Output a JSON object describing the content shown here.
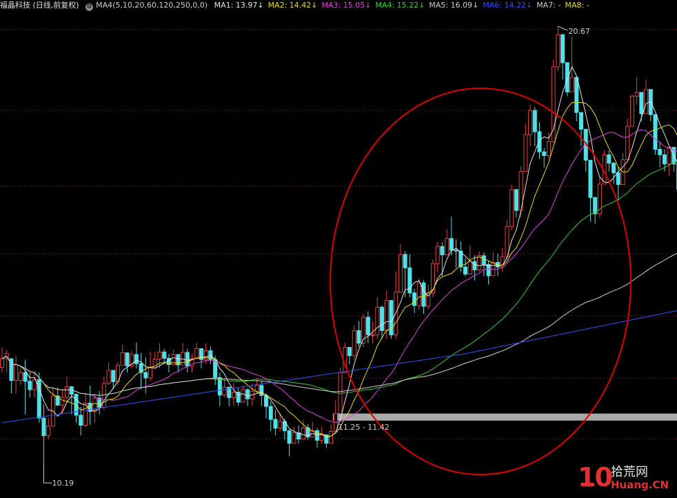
{
  "legend": {
    "title": "福晶科技 (日线,前复权)",
    "indicator": "MA4(5,10,20,60,120,250,0,0)",
    "items": [
      {
        "label": "MA1: 13.97",
        "color": "#e6e6e6",
        "arrow": "↓"
      },
      {
        "label": "MA2: 14.42",
        "color": "#e8e000",
        "arrow": "↓"
      },
      {
        "label": "MA3: 15.05",
        "color": "#e040e0",
        "arrow": "↓"
      },
      {
        "label": "MA4: 15.22",
        "color": "#30d030",
        "arrow": "↓"
      },
      {
        "label": "MA5: 16.09",
        "color": "#d0d0d0",
        "arrow": "↓"
      },
      {
        "label": "MA6: 14.22",
        "color": "#3050ff",
        "arrow": "↓"
      },
      {
        "label": "MA7: -",
        "color": "#d0d0d0",
        "arrow": ""
      },
      {
        "label": "MA8: -",
        "color": "#e8e000",
        "arrow": ""
      }
    ]
  },
  "watermark": {
    "num": "10",
    "cn": "拾荒网",
    "en": "Huang.CN"
  },
  "chart_data": {
    "type": "candlestick",
    "ylim": [
      9.6,
      21.0
    ],
    "annotations": {
      "high": "20.67",
      "low": "10.19",
      "band": "11.25 - 11.42",
      "band_range": [
        11.25,
        11.42
      ]
    },
    "colors": {
      "up": "#e84040",
      "down": "#50e0e8",
      "grid": "#6a1a1a",
      "ma1": "#e6e6e6",
      "ma2": "#e8e000",
      "ma3": "#e040e0",
      "ma4": "#30d030",
      "ma5": "#d0d0d0",
      "ma6": "#3050ff",
      "circle": "#e00000",
      "band": "#a8a8a8"
    },
    "candles": [
      [
        12.52,
        12.73,
        13.0,
        12.4
      ],
      [
        12.73,
        12.85,
        12.94,
        12.4
      ],
      [
        12.73,
        12.21,
        12.73,
        11.9
      ],
      [
        12.21,
        12.58,
        12.8,
        11.9
      ],
      [
        12.21,
        12.4,
        12.57,
        12.1
      ],
      [
        12.4,
        12.19,
        12.7,
        11.4
      ],
      [
        12.19,
        11.99,
        12.4,
        11.8
      ],
      [
        11.99,
        12.23,
        12.43,
        11.8
      ],
      [
        12.23,
        11.31,
        12.4,
        11.2
      ],
      [
        11.31,
        10.89,
        11.64,
        10.19
      ],
      [
        10.89,
        11.12,
        11.32,
        10.8
      ],
      [
        11.12,
        11.84,
        12.05,
        11.8
      ],
      [
        11.84,
        11.62,
        12.04,
        11.6
      ],
      [
        11.62,
        11.81,
        11.98,
        11.4
      ],
      [
        11.81,
        12.06,
        12.3,
        11.7
      ],
      [
        12.06,
        11.88,
        12.08,
        11.4
      ],
      [
        11.88,
        11.38,
        11.9,
        11.2
      ],
      [
        11.38,
        11.14,
        11.58,
        10.9
      ],
      [
        11.14,
        11.67,
        11.91,
        11.1
      ],
      [
        11.67,
        11.47,
        12.09,
        11.15
      ],
      [
        11.47,
        11.79,
        11.9,
        11.2
      ],
      [
        11.79,
        11.57,
        11.96,
        11.4
      ],
      [
        11.57,
        12.14,
        12.3,
        11.5
      ],
      [
        12.14,
        12.45,
        12.64,
        12.1
      ],
      [
        12.45,
        12.18,
        12.44,
        12.0
      ],
      [
        12.18,
        12.57,
        12.64,
        12.1
      ],
      [
        12.57,
        12.87,
        13.07,
        12.6
      ],
      [
        12.87,
        12.56,
        12.88,
        12.4
      ],
      [
        12.56,
        12.83,
        12.92,
        12.5
      ],
      [
        12.83,
        12.61,
        13.12,
        12.5
      ],
      [
        12.61,
        12.4,
        12.87,
        12.0
      ],
      [
        12.4,
        12.27,
        12.76,
        11.9
      ],
      [
        12.27,
        12.51,
        12.9,
        12.2
      ],
      [
        12.51,
        12.72,
        12.9,
        12.5
      ],
      [
        12.72,
        12.89,
        13.1,
        12.5
      ],
      [
        12.89,
        12.74,
        12.96,
        12.6
      ],
      [
        12.74,
        12.59,
        12.84,
        12.4
      ],
      [
        12.59,
        12.83,
        12.94,
        12.6
      ],
      [
        12.83,
        12.58,
        12.8,
        12.4
      ],
      [
        12.58,
        12.88,
        13.1,
        12.6
      ],
      [
        12.88,
        12.55,
        12.97,
        12.4
      ],
      [
        12.55,
        12.73,
        12.85,
        12.4
      ],
      [
        12.73,
        12.97,
        13.11,
        12.8
      ],
      [
        12.97,
        12.71,
        12.94,
        12.5
      ],
      [
        12.71,
        12.92,
        13.09,
        12.6
      ],
      [
        12.92,
        12.71,
        13.02,
        12.6
      ],
      [
        12.71,
        12.28,
        12.8,
        12.1
      ],
      [
        12.28,
        11.86,
        12.4,
        11.6
      ],
      [
        11.86,
        12.05,
        12.24,
        11.8
      ],
      [
        12.05,
        11.8,
        12.04,
        11.6
      ],
      [
        11.8,
        11.93,
        12.15,
        11.6
      ],
      [
        11.93,
        11.69,
        12.03,
        11.6
      ],
      [
        11.69,
        11.99,
        12.09,
        11.7
      ],
      [
        11.99,
        11.77,
        12.02,
        11.6
      ],
      [
        11.77,
        11.95,
        12.14,
        11.6
      ],
      [
        11.95,
        12.09,
        12.26,
        11.9
      ],
      [
        12.09,
        11.85,
        12.19,
        11.6
      ],
      [
        11.85,
        11.59,
        11.9,
        11.3
      ],
      [
        11.59,
        11.28,
        11.71,
        11.0
      ],
      [
        11.28,
        11.07,
        11.5,
        10.9
      ],
      [
        11.07,
        11.23,
        11.44,
        11.0
      ],
      [
        11.23,
        11.01,
        11.3,
        10.8
      ],
      [
        11.01,
        10.71,
        11.04,
        10.4
      ],
      [
        10.71,
        10.96,
        11.1,
        10.7
      ],
      [
        10.96,
        10.81,
        11.13,
        10.7
      ],
      [
        10.81,
        11.08,
        11.27,
        10.8
      ],
      [
        11.08,
        10.86,
        11.16,
        10.8
      ],
      [
        10.86,
        11.01,
        11.22,
        10.9
      ],
      [
        11.01,
        10.78,
        11.07,
        10.6
      ],
      [
        10.78,
        10.91,
        11.11,
        10.7
      ],
      [
        10.91,
        10.71,
        10.92,
        10.6
      ],
      [
        10.71,
        10.99,
        11.17,
        10.7
      ],
      [
        10.99,
        11.42,
        11.73,
        11.25
      ],
      [
        11.42,
        12.4,
        12.52,
        11.4
      ],
      [
        12.4,
        13.0,
        13.11,
        12.8
      ],
      [
        13.0,
        12.8,
        13.0,
        12.6
      ],
      [
        12.8,
        13.4,
        13.52,
        12.7
      ],
      [
        13.4,
        13.1,
        13.63,
        13.0
      ],
      [
        13.1,
        13.72,
        13.8,
        13.0
      ],
      [
        13.72,
        13.3,
        13.86,
        13.1
      ],
      [
        13.3,
        13.3,
        13.62,
        13.1
      ],
      [
        13.3,
        13.96,
        14.2,
        13.2
      ],
      [
        13.96,
        13.4,
        14.0,
        13.2
      ],
      [
        13.4,
        14.12,
        14.35,
        13.2
      ],
      [
        14.12,
        13.3,
        14.11,
        13.2
      ],
      [
        13.3,
        14.32,
        14.81,
        13.2
      ],
      [
        14.32,
        15.22,
        15.47,
        14.4
      ],
      [
        15.22,
        14.9,
        15.3,
        14.2
      ],
      [
        14.9,
        14.3,
        15.23,
        14.2
      ],
      [
        14.3,
        14.0,
        14.4,
        13.82
      ],
      [
        14.0,
        14.54,
        14.64,
        13.9
      ],
      [
        14.54,
        13.98,
        14.6,
        13.8
      ],
      [
        13.98,
        14.3,
        14.5,
        13.9
      ],
      [
        14.3,
        15.0,
        15.1,
        14.2
      ],
      [
        15.0,
        15.41,
        15.52,
        14.8
      ],
      [
        15.41,
        15.21,
        15.51,
        14.7
      ],
      [
        15.21,
        15.6,
        15.82,
        15.2
      ],
      [
        15.6,
        15.32,
        16.12,
        15.2
      ],
      [
        15.32,
        15.3,
        15.58,
        14.9
      ],
      [
        15.3,
        14.92,
        15.53,
        14.8
      ],
      [
        14.92,
        14.75,
        15.13,
        14.7
      ],
      [
        14.75,
        15.05,
        15.43,
        14.8
      ],
      [
        15.05,
        14.85,
        15.2,
        14.6
      ],
      [
        14.85,
        15.19,
        15.3,
        14.8
      ],
      [
        15.19,
        14.98,
        15.27,
        14.7
      ],
      [
        14.98,
        14.71,
        15.07,
        14.5
      ],
      [
        14.71,
        15.03,
        15.27,
        14.8
      ],
      [
        15.03,
        14.92,
        15.24,
        14.7
      ],
      [
        14.92,
        15.17,
        15.37,
        14.8
      ],
      [
        15.17,
        15.89,
        16.04,
        15.1
      ],
      [
        15.89,
        16.77,
        16.88,
        15.8
      ],
      [
        16.77,
        16.27,
        16.74,
        16.1
      ],
      [
        16.27,
        17.2,
        17.33,
        16.1
      ],
      [
        17.2,
        18.08,
        18.33,
        17.2
      ],
      [
        18.08,
        18.66,
        18.8,
        17.8
      ],
      [
        18.66,
        18.15,
        18.74,
        17.8
      ],
      [
        18.15,
        17.67,
        18.38,
        17.5
      ],
      [
        17.67,
        17.58,
        17.76,
        17.3
      ],
      [
        17.58,
        17.91,
        18.14,
        17.5
      ],
      [
        17.91,
        19.7,
        19.87,
        17.9
      ],
      [
        19.7,
        20.47,
        20.67,
        19.6
      ],
      [
        20.47,
        19.8,
        20.44,
        19.4
      ],
      [
        19.8,
        19.1,
        19.69,
        19.0
      ],
      [
        19.1,
        19.45,
        20.42,
        19.3
      ],
      [
        19.45,
        18.61,
        19.35,
        18.4
      ],
      [
        18.61,
        18.21,
        18.4,
        17.8
      ],
      [
        18.21,
        17.47,
        18.01,
        17.2
      ],
      [
        17.47,
        16.58,
        17.32,
        16.0
      ],
      [
        16.58,
        16.19,
        16.6,
        15.95
      ],
      [
        16.19,
        16.9,
        17.08,
        16.1
      ],
      [
        16.9,
        17.6,
        17.7,
        16.9
      ],
      [
        17.6,
        17.4,
        17.7,
        17.2
      ],
      [
        17.4,
        17.17,
        17.43,
        16.9
      ],
      [
        17.17,
        16.89,
        17.31,
        16.5
      ],
      [
        16.89,
        17.48,
        17.64,
        17.1
      ],
      [
        17.48,
        18.28,
        18.47,
        17.5
      ],
      [
        18.28,
        19.0,
        19.04,
        18.3
      ],
      [
        19.0,
        19.09,
        19.46,
        18.8
      ],
      [
        19.09,
        18.58,
        19.09,
        18.4
      ],
      [
        18.58,
        19.16,
        19.39,
        18.7
      ],
      [
        19.16,
        18.56,
        18.83,
        18.4
      ],
      [
        18.56,
        17.73,
        18.23,
        17.6
      ],
      [
        17.73,
        17.6,
        17.9,
        17.3
      ],
      [
        17.6,
        17.38,
        17.73,
        17.2
      ],
      [
        17.38,
        17.78,
        17.8,
        17.1
      ],
      [
        17.78,
        17.38,
        17.7,
        17.2
      ],
      [
        17.38,
        16.78,
        17.23,
        16.7
      ]
    ]
  }
}
